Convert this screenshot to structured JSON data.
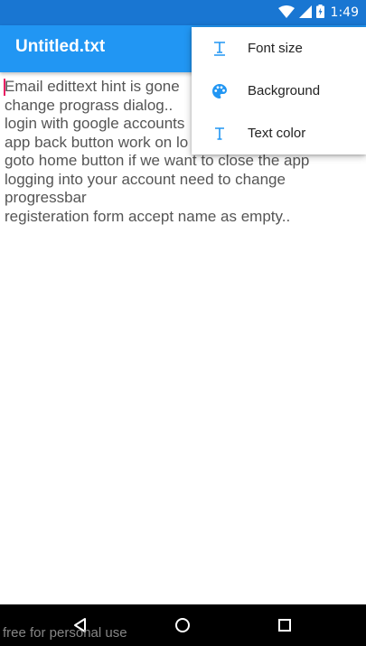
{
  "status_bar": {
    "time": "1:49",
    "icons": [
      "wifi-icon",
      "signal-icon",
      "battery-charging-icon"
    ],
    "background": "#1976d2"
  },
  "app_bar": {
    "title": "Untitled.txt",
    "background": "#2196f3"
  },
  "editor": {
    "lines": [
      "Email edittext hint is gone",
      "change prograss dialog..",
      "login with google accounts",
      "app back button work on lo",
      "goto home button if we want to close the app",
      "logging into your account need to change",
      "progressbar",
      "registeration form accept name as empty.."
    ],
    "cursor_color": "#e91e63"
  },
  "menu": {
    "items": [
      {
        "label": "Font size",
        "icon": "font-size-icon"
      },
      {
        "label": "Background",
        "icon": "palette-icon"
      },
      {
        "label": "Text color",
        "icon": "text-color-icon"
      }
    ],
    "icon_color": "#2196f3"
  },
  "nav_bar": {
    "buttons": [
      "back-icon",
      "home-icon",
      "recents-icon"
    ]
  },
  "watermark": "free for personal use"
}
